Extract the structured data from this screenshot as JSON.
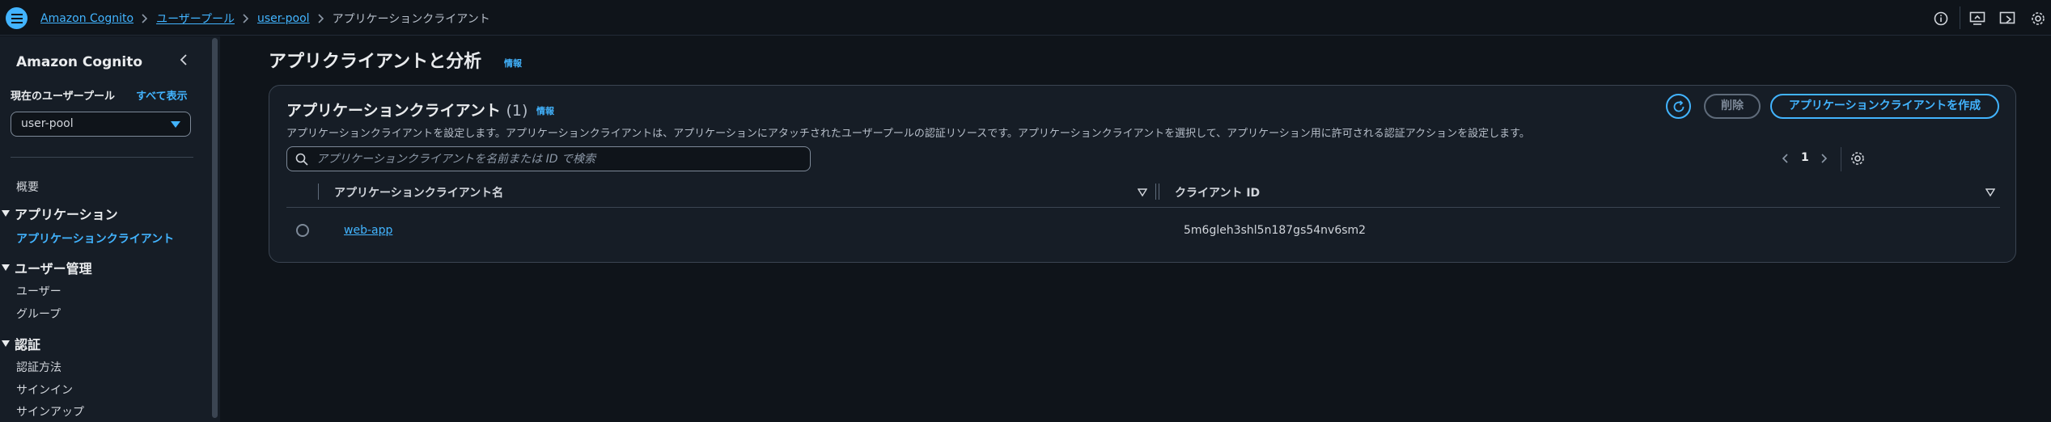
{
  "topbar": {
    "breadcrumbs": [
      {
        "label": "Amazon Cognito"
      },
      {
        "label": "ユーザープール"
      },
      {
        "label": "user-pool"
      }
    ],
    "current": "アプリケーションクライアント"
  },
  "sidebar": {
    "title": "Amazon Cognito",
    "pool_label": "現在のユーザープール",
    "show_all": "すべて表示",
    "selected_pool": "user-pool",
    "overview": "概要",
    "sections": [
      {
        "label": "アプリケーション",
        "items": [
          {
            "label": "アプリケーションクライアント",
            "active": true
          }
        ]
      },
      {
        "label": "ユーザー管理",
        "items": [
          {
            "label": "ユーザー"
          },
          {
            "label": "グループ"
          }
        ]
      },
      {
        "label": "認証",
        "items": [
          {
            "label": "認証方法"
          },
          {
            "label": "サインイン"
          },
          {
            "label": "サインアップ"
          }
        ]
      }
    ]
  },
  "main": {
    "page_title": "アプリクライアントと分析",
    "info": "情報",
    "panel": {
      "title": "アプリケーションクライアント",
      "count": "(1)",
      "info": "情報",
      "description": "アプリケーションクライアントを設定します。アプリケーションクライアントは、アプリケーションにアタッチされたユーザープールの認証リソースです。アプリケーションクライアントを選択して、アプリケーション用に許可される認証アクションを設定します。",
      "delete_label": "削除",
      "create_label": "アプリケーションクライアントを作成",
      "search_placeholder": "アプリケーションクライアントを名前または ID で検索",
      "page": "1",
      "columns": [
        "アプリケーションクライアント名",
        "クライアント ID"
      ],
      "rows": [
        {
          "name": "web-app",
          "client_id": "5m6gleh3shl5n187gs54nv6sm2"
        }
      ]
    }
  },
  "colors": {
    "accent": "#42b4ff",
    "background": "#0f141a",
    "panel": "#161d26"
  }
}
